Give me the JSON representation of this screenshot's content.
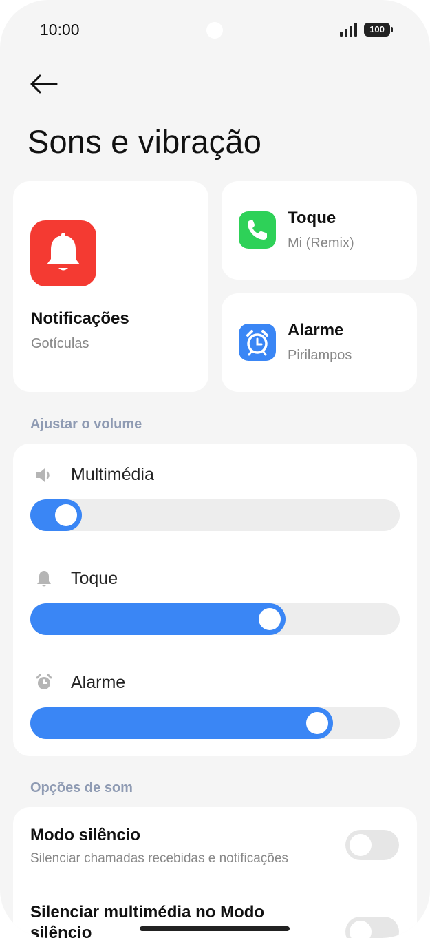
{
  "status_bar": {
    "time": "10:00",
    "battery": "100"
  },
  "header": {
    "back_icon": "arrow-left-icon",
    "title": "Sons e vibração"
  },
  "tiles": {
    "notifications": {
      "title": "Notificações",
      "subtitle": "Gotículas",
      "icon": "bell-icon",
      "color": "#f43a32"
    },
    "ringtone": {
      "title": "Toque",
      "subtitle": "Mi (Remix)",
      "icon": "phone-icon",
      "color": "#2ed158"
    },
    "alarm": {
      "title": "Alarme",
      "subtitle": "Pirilampos",
      "icon": "alarm-clock-icon",
      "color": "#3a86f5"
    }
  },
  "volume": {
    "section_label": "Ajustar o volume",
    "accent": "#3a86f5",
    "sliders": [
      {
        "label": "Multimédia",
        "icon": "speaker-icon",
        "level": 0.14
      },
      {
        "label": "Toque",
        "icon": "bell-icon",
        "level": 0.69
      },
      {
        "label": "Alarme",
        "icon": "alarm-clock-icon",
        "level": 0.82
      }
    ]
  },
  "sound_options": {
    "section_label": "Opções de som",
    "items": [
      {
        "title": "Modo silêncio",
        "subtitle": "Silenciar chamadas recebidas e notificações",
        "enabled": false
      },
      {
        "title": "Silenciar multimédia no Modo silêncio",
        "enabled": false
      }
    ]
  }
}
